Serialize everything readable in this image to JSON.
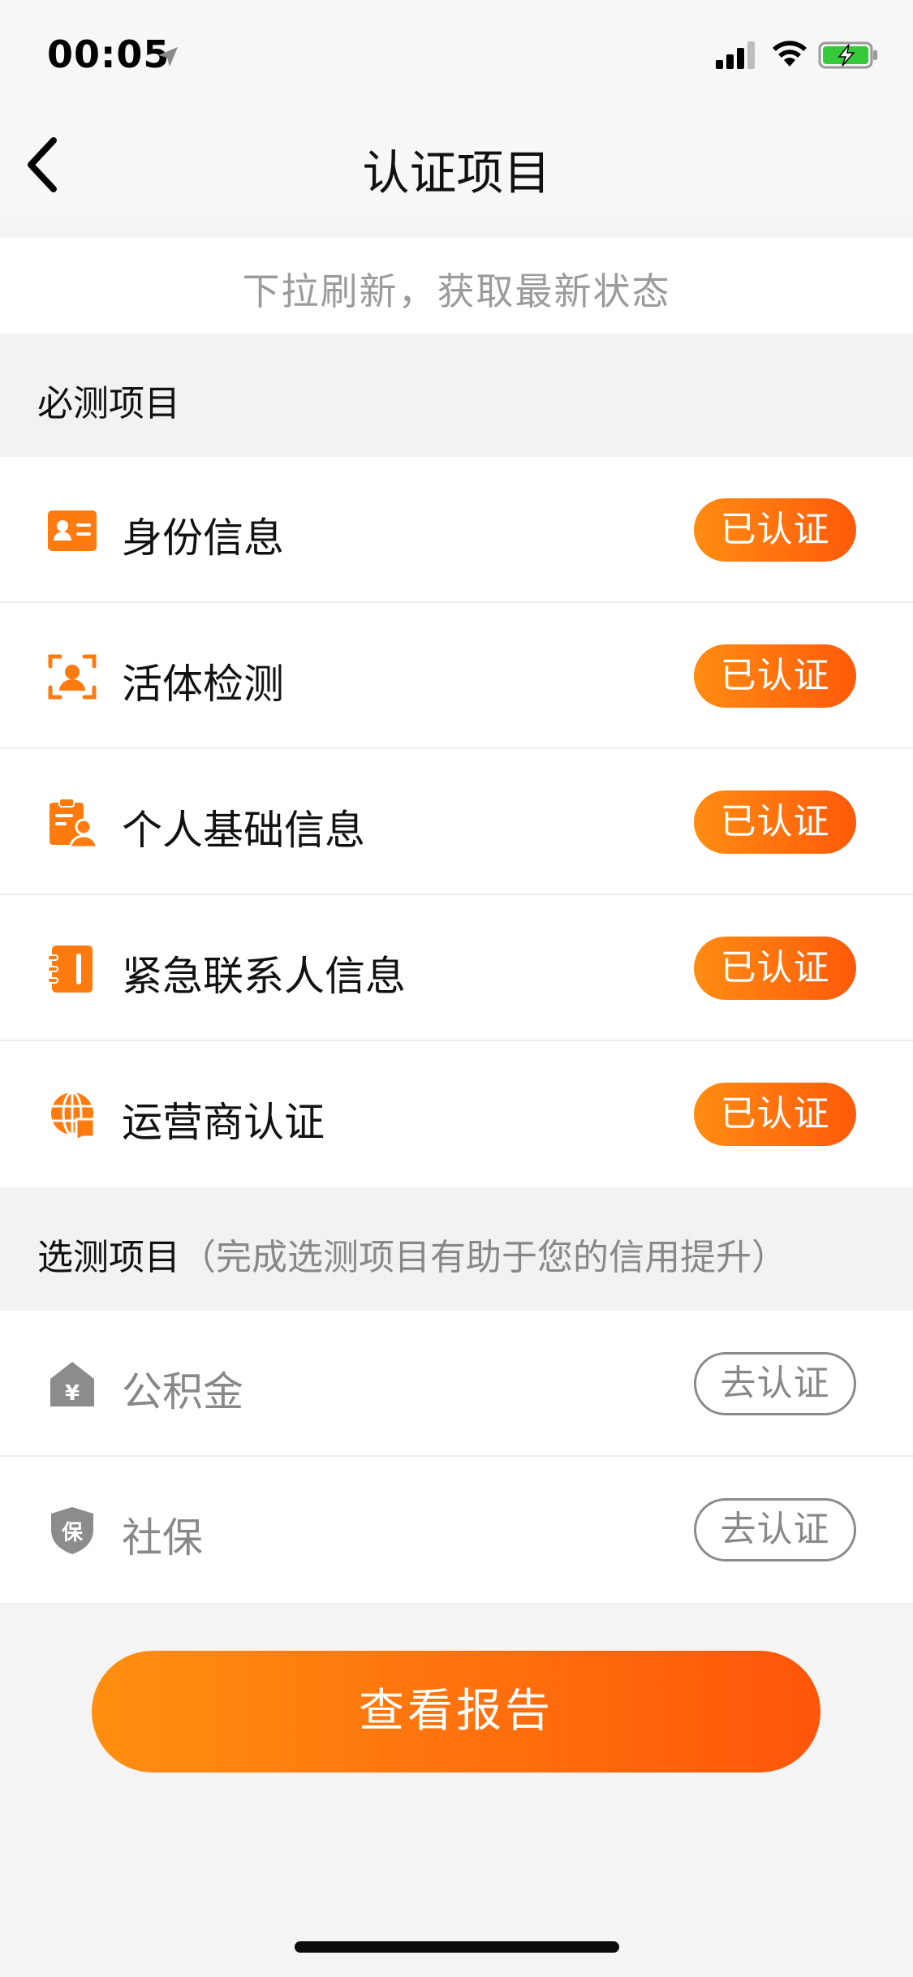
{
  "status_bar": {
    "time": "00:05"
  },
  "nav": {
    "title": "认证项目"
  },
  "refresh_hint": "下拉刷新，获取最新状态",
  "required": {
    "title": "必测项目",
    "items": [
      {
        "label": "身份信息",
        "status": "已认证",
        "icon": "id-card-icon"
      },
      {
        "label": "活体检测",
        "status": "已认证",
        "icon": "face-scan-icon"
      },
      {
        "label": "个人基础信息",
        "status": "已认证",
        "icon": "personal-info-icon"
      },
      {
        "label": "紧急联系人信息",
        "status": "已认证",
        "icon": "contact-book-icon"
      },
      {
        "label": "运营商认证",
        "status": "已认证",
        "icon": "carrier-globe-icon"
      }
    ]
  },
  "optional": {
    "title": "选测项目",
    "note": "（完成选测项目有助于您的信用提升）",
    "items": [
      {
        "label": "公积金",
        "status": "去认证",
        "icon": "housing-fund-icon"
      },
      {
        "label": "社保",
        "status": "去认证",
        "icon": "social-insurance-shield-icon"
      }
    ]
  },
  "report_button": "查看报告",
  "colors": {
    "accent_start": "#ff8c12",
    "accent_end": "#ff5a0a",
    "icon_orange": "#ff7a0f",
    "muted": "#888888"
  }
}
